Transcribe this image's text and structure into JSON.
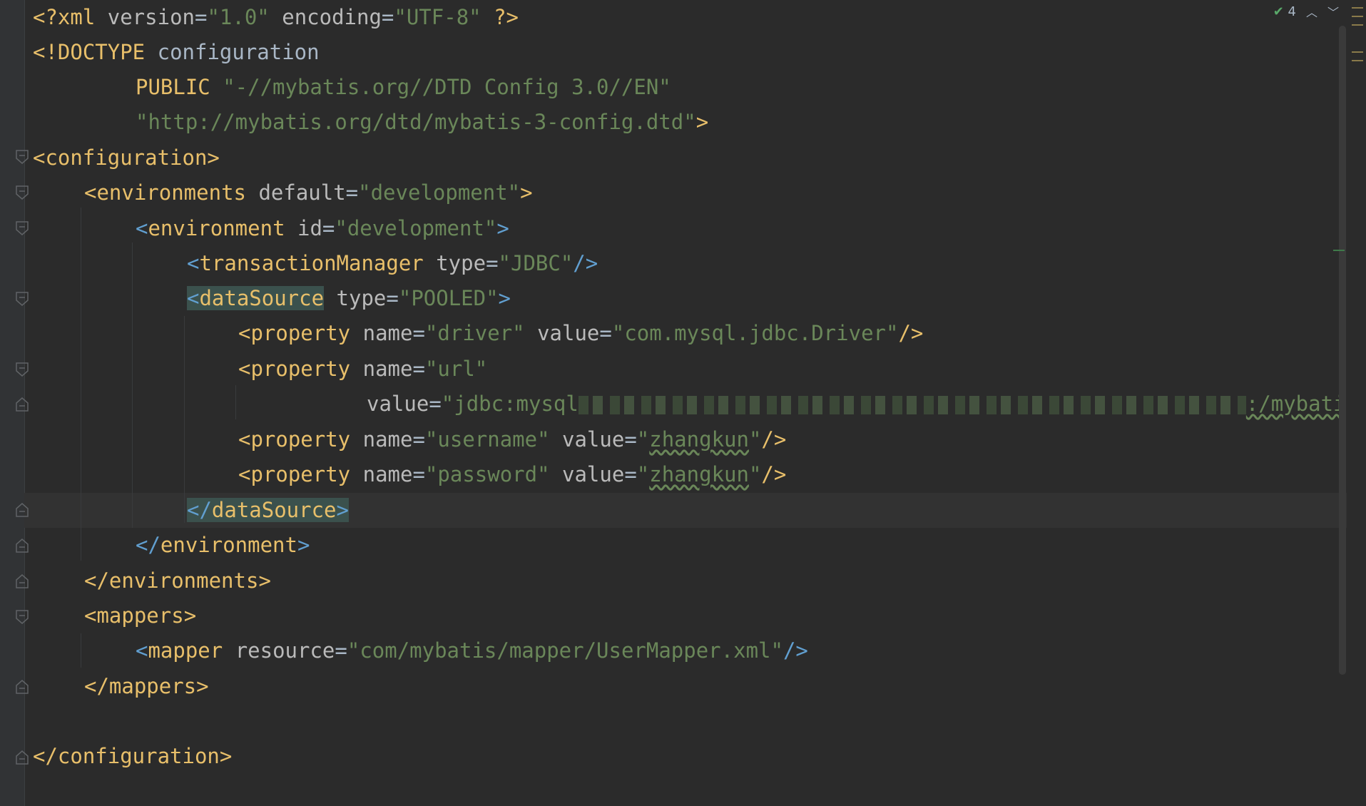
{
  "inspection": {
    "count": "4"
  },
  "code": {
    "l1": {
      "open": "<?xml ",
      "a1": "version",
      "v1": "\"1.0\"",
      "a2": "encoding",
      "v2": "\"UTF-8\"",
      "close": " ?>"
    },
    "l2": {
      "text": "<!DOCTYPE ",
      "rest": "configuration"
    },
    "l3": {
      "kw": "PUBLIC ",
      "val": "\"-//mybatis.org//DTD Config 3.0//EN\""
    },
    "l4": {
      "val": "\"http://mybatis.org/dtd/mybatis-3-config.dtd\"",
      "close": ">"
    },
    "l5": {
      "tag": "<configuration>"
    },
    "l6": {
      "name": "environments",
      "attr": "default",
      "val": "\"development\""
    },
    "l7": {
      "name": "environment",
      "attr": "id",
      "val": "\"development\""
    },
    "l8": {
      "name": "transactionManager",
      "attr": "type",
      "val": "\"JDBC\""
    },
    "l9": {
      "name": "dataSource",
      "attr": "type",
      "val": "\"POOLED\""
    },
    "l10": {
      "name": "property",
      "a1": "name",
      "v1": "\"driver\"",
      "a2": "value",
      "v2": "\"com.mysql.jdbc.Driver\""
    },
    "l11": {
      "name": "property",
      "a1": "name",
      "v1": "\"url\""
    },
    "l12": {
      "a": "value",
      "v": "\"jdbc:mysql",
      "tail": ":/mybati"
    },
    "l13": {
      "name": "property",
      "a1": "name",
      "v1": "\"username\"",
      "a2": "value",
      "v2q": "\"",
      "v2": "zhangkun",
      "v2e": "\""
    },
    "l14": {
      "name": "property",
      "a1": "name",
      "v1": "\"password\"",
      "a2": "value",
      "v2q": "\"",
      "v2": "zhangkun",
      "v2e": "\""
    },
    "l15": {
      "name": "dataSource"
    },
    "l16": {
      "name": "environment"
    },
    "l17": {
      "name": "environments"
    },
    "l18": {
      "name": "mappers"
    },
    "l19": {
      "name": "mapper",
      "attr": "resource",
      "val": "\"com/mybatis/mapper/UserMapper.xml\""
    },
    "l20": {
      "name": "mappers"
    },
    "l22": {
      "tag": "</configuration>"
    }
  },
  "colors": {
    "background": "#2b2b2b",
    "tag": "#e8bf6a",
    "attribute": "#bababa",
    "value": "#6a8759",
    "angle_bracket": "#619fd0"
  }
}
